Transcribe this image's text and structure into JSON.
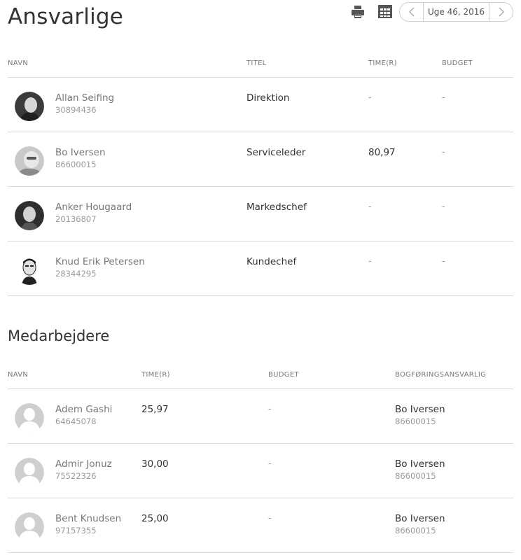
{
  "title": "Ansvarlige",
  "toolbar": {
    "print_icon": "print-icon",
    "calendar_icon": "calendar-grid-icon",
    "prev_icon": "chevron-left-icon",
    "next_icon": "chevron-right-icon",
    "week_label": "Uge 46, 2016"
  },
  "responsible": {
    "headers": {
      "name": "NAVN",
      "title": "TITEL",
      "hours": "TIME(R)",
      "budget": "BUDGET"
    },
    "rows": [
      {
        "name": "Allan Seifing",
        "number": "30894436",
        "title": "Direktion",
        "hours": "-",
        "budget": "-"
      },
      {
        "name": "Bo Iversen",
        "number": "86600015",
        "title": "Serviceleder",
        "hours": "80,97",
        "budget": "-"
      },
      {
        "name": "Anker Hougaard",
        "number": "20136807",
        "title": "Markedschef",
        "hours": "-",
        "budget": "-"
      },
      {
        "name": "Knud Erik Petersen",
        "number": "28344295",
        "title": "Kundechef",
        "hours": "-",
        "budget": "-"
      }
    ]
  },
  "employees_title": "Medarbejdere",
  "employees": {
    "headers": {
      "name": "NAVN",
      "hours": "TIME(R)",
      "budget": "BUDGET",
      "responsible": "BOGFØRINGSANSVARLIG"
    },
    "rows": [
      {
        "name": "Adem Gashi",
        "number": "64645078",
        "hours": "25,97",
        "budget": "-",
        "resp_name": "Bo Iversen",
        "resp_number": "86600015"
      },
      {
        "name": "Admir Jonuz",
        "number": "75522326",
        "hours": "30,00",
        "budget": "-",
        "resp_name": "Bo Iversen",
        "resp_number": "86600015"
      },
      {
        "name": "Bent Knudsen",
        "number": "97157355",
        "hours": "25,00",
        "budget": "-",
        "resp_name": "Bo Iversen",
        "resp_number": "86600015"
      }
    ]
  }
}
